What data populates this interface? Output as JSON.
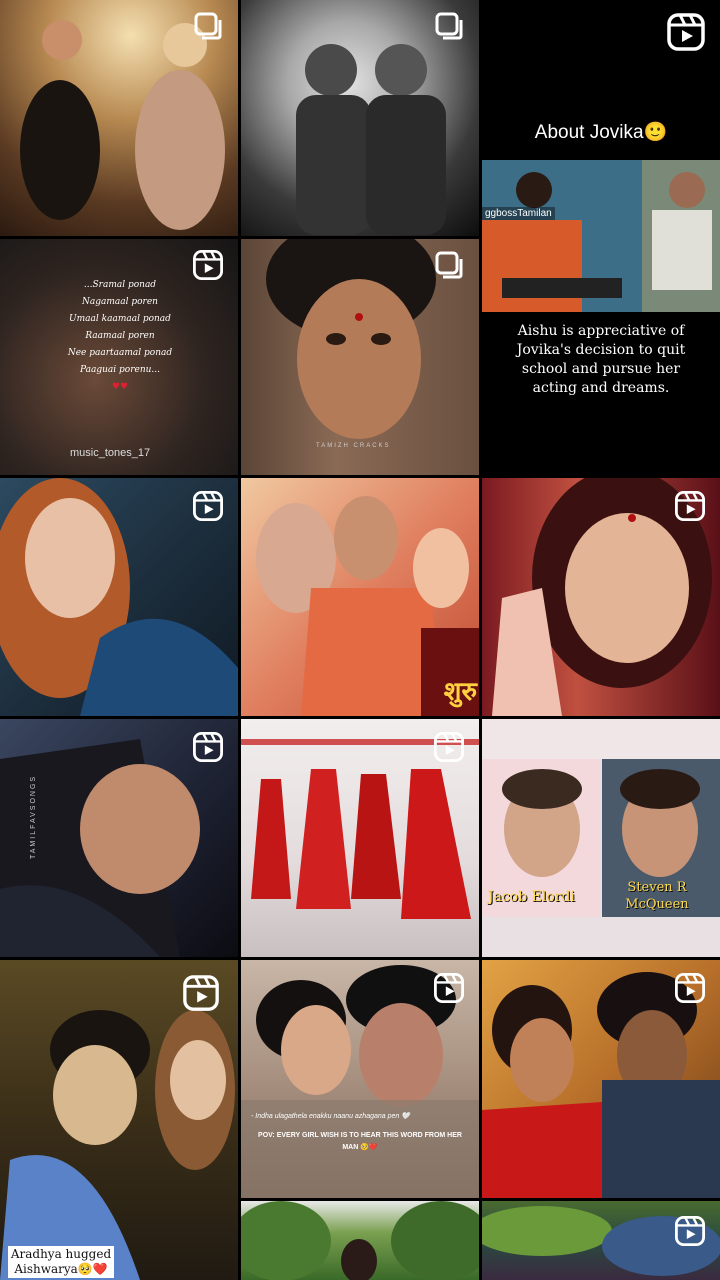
{
  "explore_grid": {
    "tiles": [
      {
        "id": "t1",
        "badge": "multi"
      },
      {
        "id": "t2",
        "badge": "multi"
      },
      {
        "id": "t3",
        "badge": "reel",
        "title": "About Jovika🙂",
        "caption": "Aishu is appreciative of Jovika's decision to quit school and pursue her acting and dreams.",
        "watermark": "ggbossTamilan"
      },
      {
        "id": "t4",
        "badge": "reel",
        "lyrics": [
          "...Sramal ponad",
          "Nagamaal poren",
          "Umaal kaamaal ponad",
          "Raamaal poren",
          "Nee paartaamal ponad",
          "Paaguai porenu..."
        ],
        "watermark": "music_tones_17"
      },
      {
        "id": "t5",
        "badge": "multi",
        "watermark": "TAMIZH CRACKS"
      },
      {
        "id": "t6",
        "badge": "reel"
      },
      {
        "id": "t7",
        "badge": "none",
        "overlay_text": "शुरु"
      },
      {
        "id": "t8",
        "badge": "reel"
      },
      {
        "id": "t9",
        "badge": "reel",
        "watermark": "TAMILFAVSONGS"
      },
      {
        "id": "t10",
        "badge": "reel"
      },
      {
        "id": "t11",
        "badge": "none",
        "labels": [
          "Jacob Elordi",
          "Steven R McQueen"
        ]
      },
      {
        "id": "t12",
        "badge": "reel",
        "caption": "Aradhya hugged Aishwarya🥺❤️"
      },
      {
        "id": "t13",
        "badge": "reel",
        "captions": [
          "- Indha ulagathela enakku naanu azhagana pen 🤍",
          "POV: EVERY GIRL WISH IS TO HEAR THIS WORD FROM HER MAN 🥺❤️"
        ]
      },
      {
        "id": "t14",
        "badge": "reel"
      },
      {
        "id": "t15",
        "badge": "none"
      },
      {
        "id": "t16",
        "badge": "none"
      },
      {
        "id": "t17",
        "badge": "reel"
      }
    ]
  }
}
